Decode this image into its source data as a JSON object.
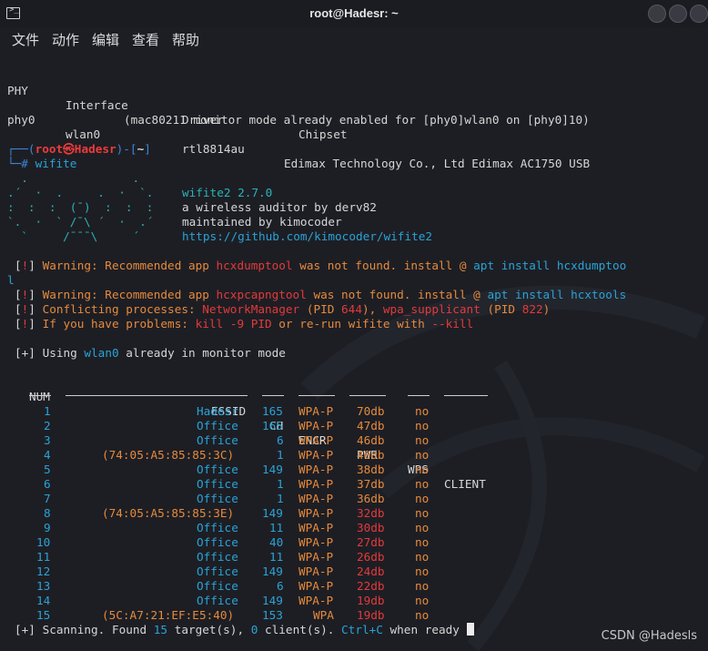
{
  "window": {
    "title": "root@Hadesr: ~",
    "controls": [
      "minimize",
      "maximize",
      "close"
    ]
  },
  "menu": {
    "items": [
      "文件",
      "动作",
      "编辑",
      "查看",
      "帮助"
    ]
  },
  "iface": {
    "headers": [
      "PHY",
      "Interface",
      "Driver",
      "Chipset"
    ],
    "row": [
      "phy0",
      "wlan0",
      "rtl8814au",
      "Edimax Technology Co., Ltd Edimax AC1750 USB"
    ],
    "note": "(mac80211 monitor mode already enabled for [phy0]wlan0 on [phy0]10)"
  },
  "prompt": {
    "open": "┌──(",
    "user": "root㉿Hadesr",
    "close": ")-[",
    "dir": "~",
    "end": "]",
    "hash": "└─#",
    "cmd": "wifite"
  },
  "banner": {
    "art": [
      "  .               .    ",
      ".´  ·  .     .  ·  `.  ",
      ":  :  :  (¯)  :  :  :  ",
      "`.  ·  ` /¯\\ ´  ·  .´  ",
      "  `     /¯¯¯\\     ´    "
    ],
    "name": "wifite2 2.7.0",
    "tagline": "a wireless auditor by derv82",
    "maintainer": "maintained by kimocoder",
    "url": "https://github.com/kimocoder/wifite2"
  },
  "warnings": {
    "bang": "!",
    "w1_prefix": "Warning: Recommended app ",
    "w1_app": "hcxdumptool",
    "w1_mid": " was not found. install @ ",
    "w1_cmd": "apt install hcxdumptoo",
    "w1_wrap": "l",
    "w2_prefix": "Warning: Recommended app ",
    "w2_app": "hcxpcapngtool",
    "w2_mid": " was not found. install @ ",
    "w2_cmd": "apt install hcxtools",
    "cp_label": "Conflicting processes: ",
    "cp_p1": "NetworkManager",
    "cp_pid_open": " (PID ",
    "cp_pid1": "644",
    "cp_sep": "), ",
    "cp_p2": "wpa_supplicant",
    "cp_pid2": "822",
    "cp_end": ")",
    "prob_label": "If you have problems: ",
    "prob_cmd1": "kill -9 PID",
    "prob_mid": " or re-run wifite with ",
    "prob_cmd2": "--kill"
  },
  "status": {
    "plus": "+",
    "using": "Using ",
    "iface": "wlan0",
    "rest": " already in monitor mode"
  },
  "table": {
    "headers": {
      "num": "NUM",
      "essid": "ESSID",
      "ch": "CH",
      "encr": "ENCR",
      "pwr": "PWR",
      "wps": "WPS",
      "client": "CLIENT"
    },
    "rows": [
      {
        "num": "1",
        "essid": "Hadesr",
        "hidden": false,
        "ch": "165",
        "encr": "WPA-P",
        "pwr": "70db",
        "level": "good",
        "wps": "no"
      },
      {
        "num": "2",
        "essid": "Office",
        "hidden": false,
        "ch": "165",
        "encr": "WPA-P",
        "pwr": "47db",
        "level": "good",
        "wps": "no"
      },
      {
        "num": "3",
        "essid": "Office",
        "hidden": false,
        "ch": "6",
        "encr": "WPA-P",
        "pwr": "46db",
        "level": "good",
        "wps": "no"
      },
      {
        "num": "4",
        "essid": "(74:05:A5:85:85:3C)",
        "hidden": true,
        "ch": "1",
        "encr": "WPA-P",
        "pwr": "40db",
        "level": "good",
        "wps": "no"
      },
      {
        "num": "5",
        "essid": "Office",
        "hidden": false,
        "ch": "149",
        "encr": "WPA-P",
        "pwr": "38db",
        "level": "good",
        "wps": "no"
      },
      {
        "num": "6",
        "essid": "Office",
        "hidden": false,
        "ch": "1",
        "encr": "WPA-P",
        "pwr": "37db",
        "level": "good",
        "wps": "no"
      },
      {
        "num": "7",
        "essid": "Office",
        "hidden": false,
        "ch": "1",
        "encr": "WPA-P",
        "pwr": "36db",
        "level": "good",
        "wps": "no"
      },
      {
        "num": "8",
        "essid": "(74:05:A5:85:85:3E)",
        "hidden": true,
        "ch": "149",
        "encr": "WPA-P",
        "pwr": "32db",
        "level": "weak",
        "wps": "no"
      },
      {
        "num": "9",
        "essid": "Office",
        "hidden": false,
        "ch": "11",
        "encr": "WPA-P",
        "pwr": "30db",
        "level": "weak",
        "wps": "no"
      },
      {
        "num": "10",
        "essid": "Office",
        "hidden": false,
        "ch": "40",
        "encr": "WPA-P",
        "pwr": "27db",
        "level": "weak",
        "wps": "no"
      },
      {
        "num": "11",
        "essid": "Office",
        "hidden": false,
        "ch": "11",
        "encr": "WPA-P",
        "pwr": "26db",
        "level": "weak",
        "wps": "no"
      },
      {
        "num": "12",
        "essid": "Office",
        "hidden": false,
        "ch": "149",
        "encr": "WPA-P",
        "pwr": "24db",
        "level": "weak",
        "wps": "no"
      },
      {
        "num": "13",
        "essid": "Office",
        "hidden": false,
        "ch": "6",
        "encr": "WPA-P",
        "pwr": "22db",
        "level": "weak",
        "wps": "no"
      },
      {
        "num": "14",
        "essid": "Office",
        "hidden": false,
        "ch": "149",
        "encr": "WPA-P",
        "pwr": "19db",
        "level": "weak",
        "wps": "no"
      },
      {
        "num": "15",
        "essid": "(5C:A7:21:EF:E5:40)",
        "hidden": true,
        "ch": "153",
        "encr": "WPA",
        "pwr": "19db",
        "level": "weak",
        "wps": "no"
      }
    ]
  },
  "scan": {
    "plus": "+",
    "text1": "Scanning. Found ",
    "targets": "15",
    "text2": " target(s), ",
    "clients": "0",
    "text3": " client(s). ",
    "key": "Ctrl+C",
    "text4": " when ready "
  },
  "watermark": "CSDN @Hadesls",
  "colors": {
    "background": "#1d1e24",
    "cyan": "#29a3d6",
    "red": "#e23a3a",
    "orange": "#e68a3c",
    "blue": "#3d86d6",
    "teal": "#29b4b6"
  }
}
